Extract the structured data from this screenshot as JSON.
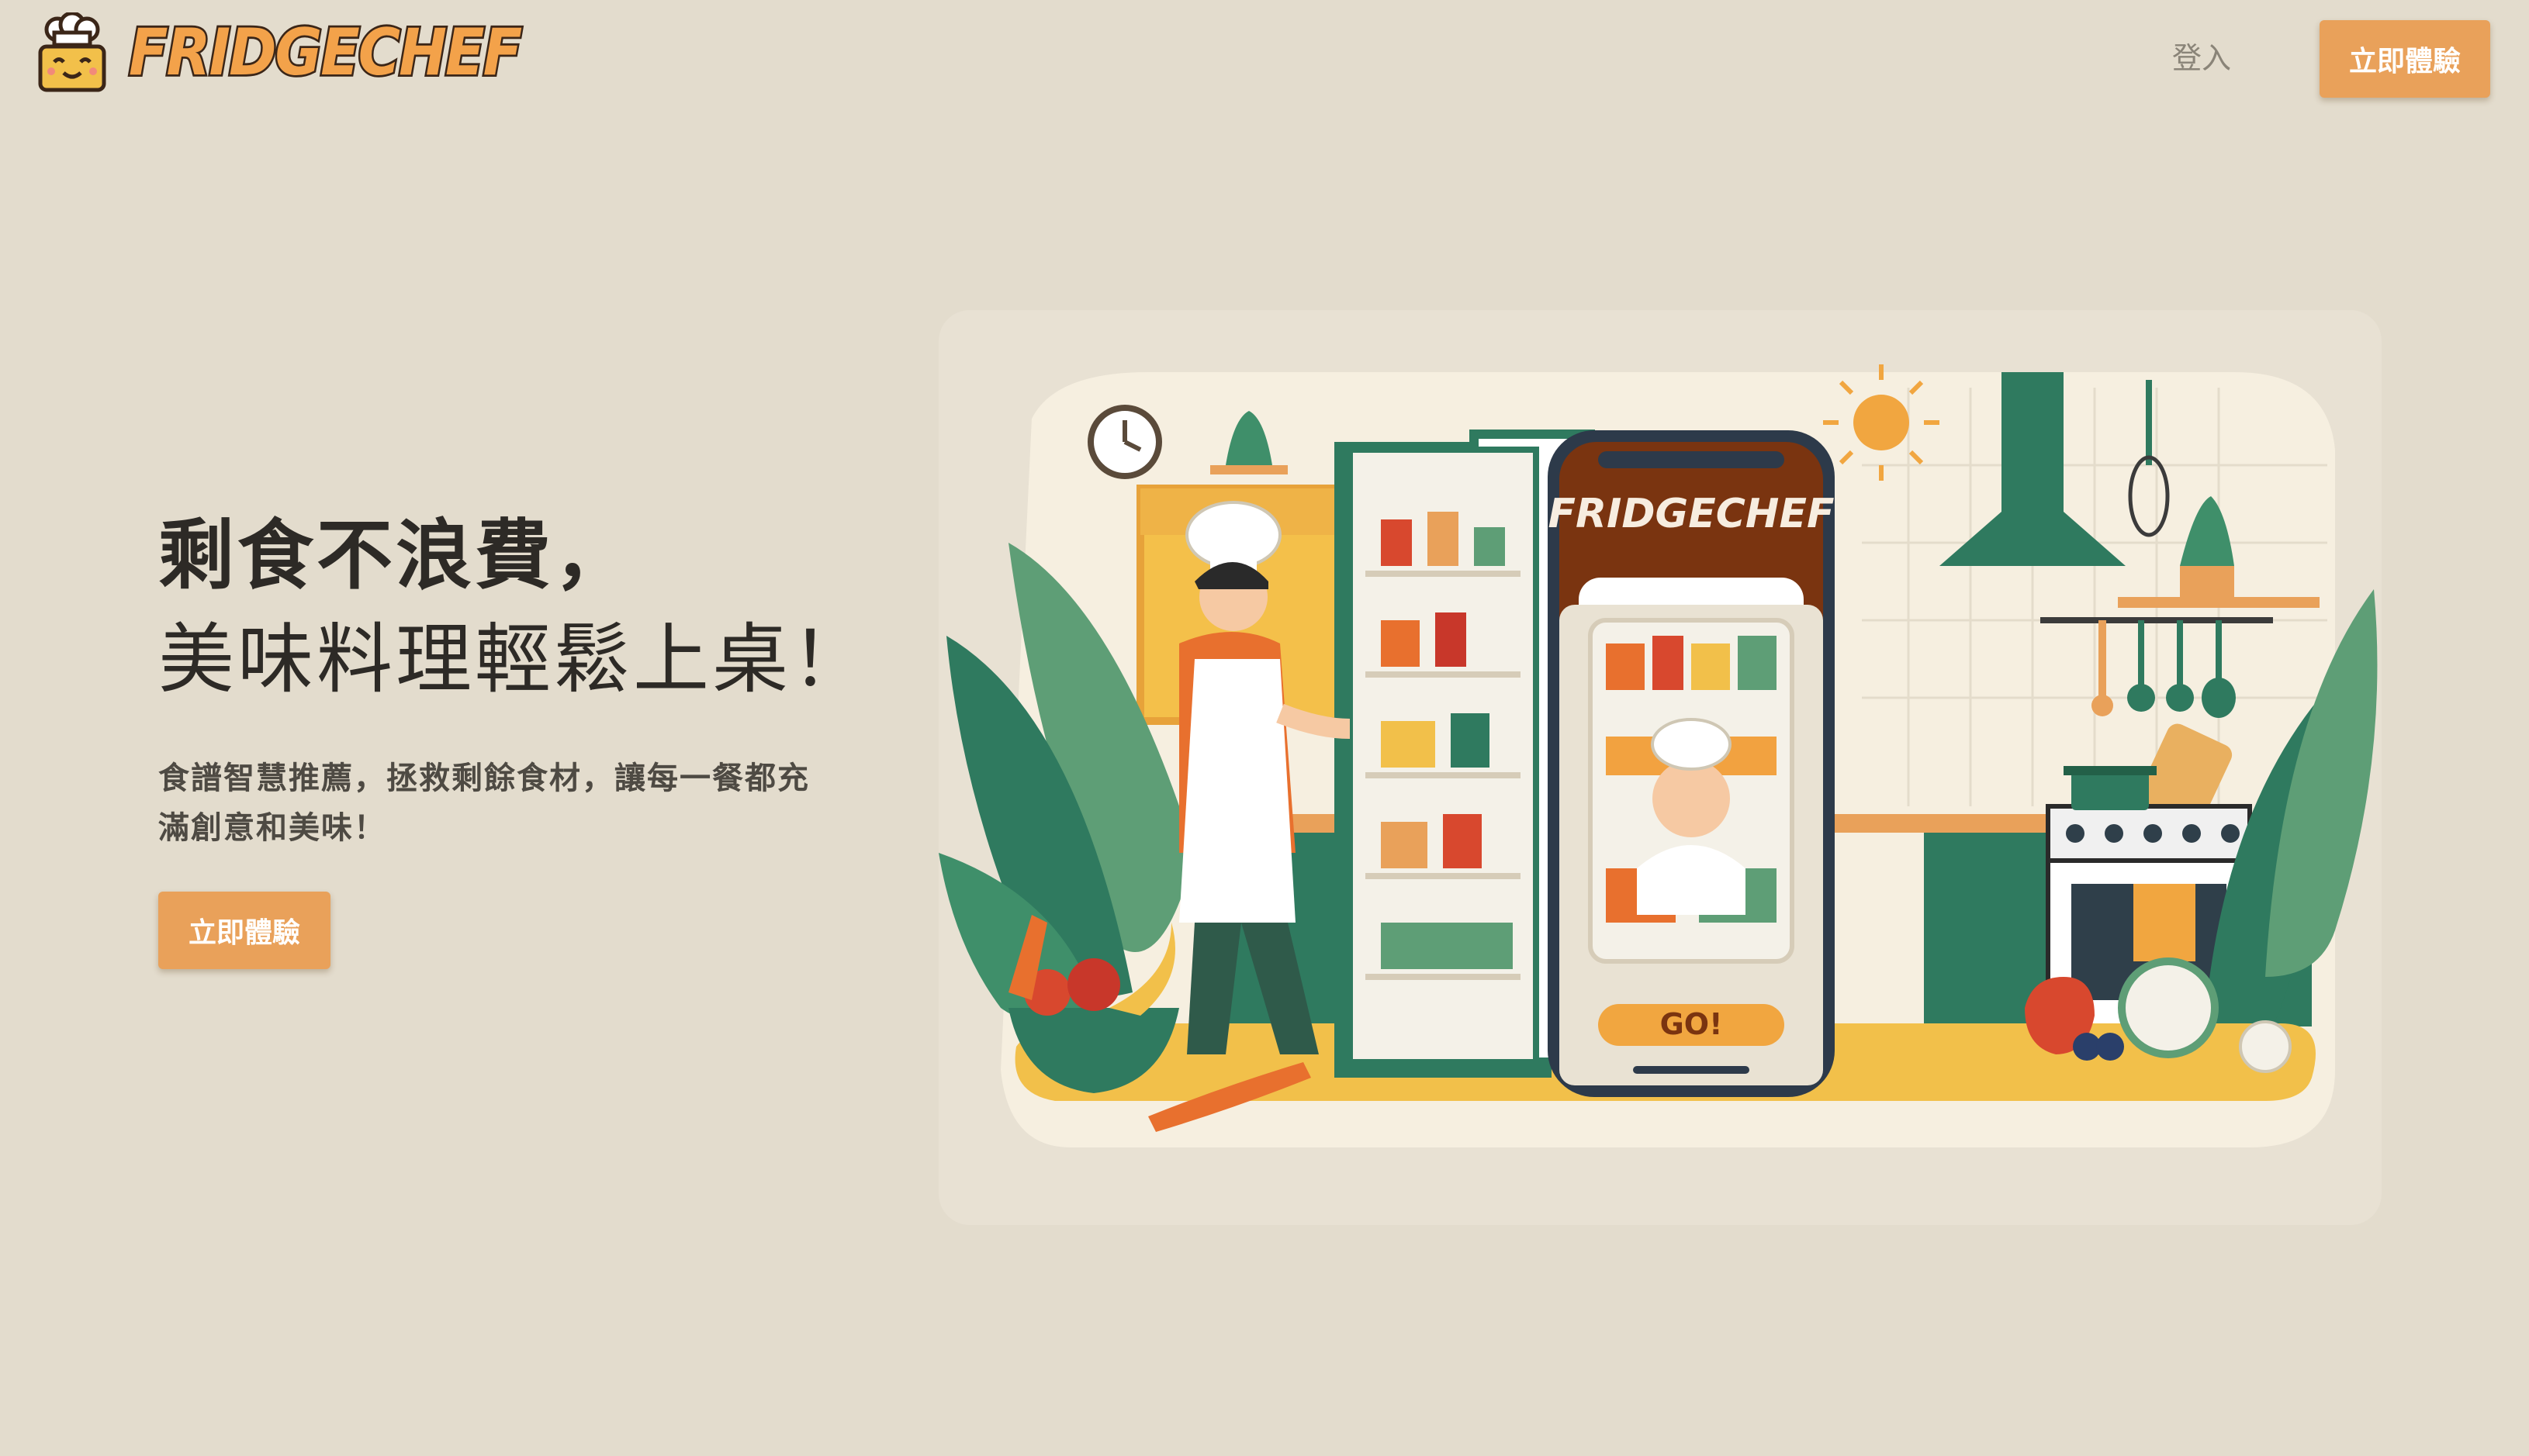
{
  "header": {
    "brand": "FRIDGECHEF",
    "login_label": "登入",
    "cta_label": "立即體驗"
  },
  "hero": {
    "title_line1": "剩食不浪費，",
    "title_line2": "美味料理輕鬆上桌！",
    "subtitle": "食譜智慧推薦，拯救剩餘食材，讓每一餐都充滿創意和美味！",
    "cta_label": "立即體驗"
  },
  "illustration": {
    "app_brand": "FRIDGECHEF",
    "go_label": "GO!"
  },
  "colors": {
    "background": "#e3dccd",
    "accent": "#e9a15a",
    "brand_green": "#2f7a5f",
    "text_dark": "#2d2a26"
  },
  "icons": [
    "chef-logo-icon",
    "sun-icon",
    "clock-icon",
    "whisk-icon"
  ]
}
